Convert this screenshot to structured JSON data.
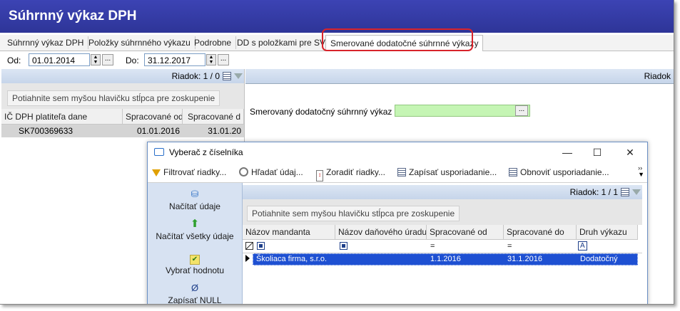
{
  "window": {
    "title": "Súhrnný výkaz DPH"
  },
  "tabs": [
    {
      "label": "Súhrnný výkaz DPH"
    },
    {
      "label": "Položky súhrnného výkazu"
    },
    {
      "label": "Podrobne"
    },
    {
      "label": "DD s položkami pre SV"
    },
    {
      "label": "Smerované dodatočné súhrnné výkazy"
    }
  ],
  "dates": {
    "from_label": "Od:",
    "from_value": "01.01.2014",
    "to_label": "Do:",
    "to_value": "31.12.2017",
    "ellipsis": "..."
  },
  "left_grid": {
    "row_counter": "Riadok: 1 / 0",
    "group_hint": "Potiahnite sem myšou hlavičku stĺpca pre zoskupenie",
    "columns": [
      "IČ DPH platiteľa dane",
      "Spracované od",
      "Spracované d"
    ],
    "row": [
      "SK700369633",
      "01.01.2016",
      "31.01.20"
    ]
  },
  "right_panel": {
    "row_counter": "Riadok",
    "field_label": "Smerovaný dodatočný súhrnný výkaz",
    "field_button": "..."
  },
  "dialog": {
    "title": "Vyberač z číselníka",
    "minimize": "—",
    "maximize": "☐",
    "close": "✕",
    "toolbar": [
      {
        "label": "Filtrovať riadky...",
        "icon": "filter-icon"
      },
      {
        "label": "Hľadať údaj...",
        "icon": "search-icon"
      },
      {
        "label": "Zoradiť riadky...",
        "icon": "sort-icon"
      },
      {
        "label": "Zapísať usporiadanie...",
        "icon": "save-layout-icon"
      },
      {
        "label": "Obnoviť usporiadanie...",
        "icon": "restore-layout-icon"
      }
    ],
    "side": [
      {
        "label": "Načítať údaje",
        "icon": "load-icon"
      },
      {
        "label": "Načítať všetky údaje",
        "icon": "load-all-icon"
      },
      {
        "label": "Vybrať hodnotu",
        "icon": "checkmark-icon"
      },
      {
        "label": "Zapísať NULL",
        "icon": "null-icon"
      }
    ],
    "row_counter": "Riadok: 1 / 1",
    "group_hint": "Potiahnite sem myšou hlavičku stĺpca pre zoskupenie",
    "columns": [
      "Názov mandanta",
      "Názov daňového úradu",
      "Spracované od",
      "Spracované do",
      "Druh výkazu"
    ],
    "filter_symbols": [
      "=",
      "=",
      "A"
    ],
    "row": [
      "Školiaca firma, s.r.o.",
      "",
      "1.1.2016",
      "31.1.2016",
      "Dodatočný"
    ]
  }
}
